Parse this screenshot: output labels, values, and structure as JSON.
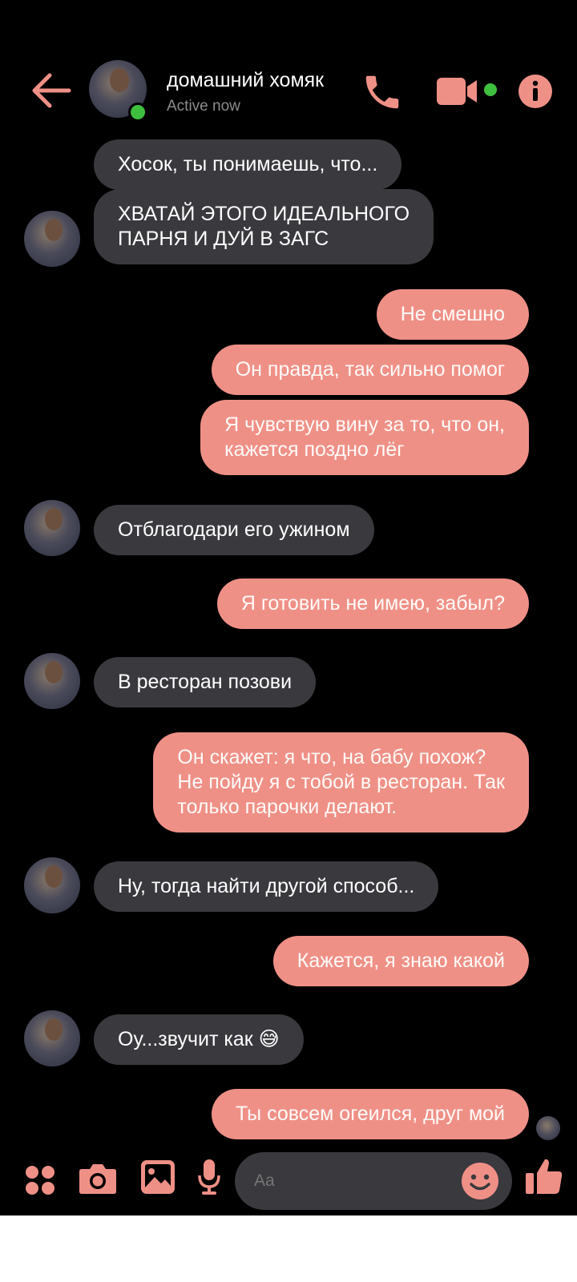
{
  "header": {
    "contact_name": "домашний хомяк",
    "status": "Active now"
  },
  "messages": [
    {
      "side": "in",
      "text": "Хосок, ты понимаешь, что...",
      "avatar": false
    },
    {
      "side": "in",
      "text": "ХВАТАЙ ЭТОГО ИДЕАЛЬНОГО\nПАРНЯ И ДУЙ В ЗАГС",
      "avatar": true
    },
    {
      "side": "out",
      "text": "Не смешно"
    },
    {
      "side": "out",
      "text": "Он правда, так сильно помог"
    },
    {
      "side": "out",
      "text": "Я чувствую вину за то, что он,\nкажется поздно лёг"
    },
    {
      "side": "in",
      "text": "Отблагодари его ужином",
      "avatar": true
    },
    {
      "side": "out",
      "text": "Я готовить не имею, забыл?"
    },
    {
      "side": "in",
      "text": "В ресторан позови",
      "avatar": true
    },
    {
      "side": "out",
      "text": "Он скажет: я что, на бабу похож?\nНе пойду я с тобой в ресторан. Так\nтолько парочки делают."
    },
    {
      "side": "in",
      "text": "Ну, тогда найти другой способ...",
      "avatar": true
    },
    {
      "side": "out",
      "text": "Кажется, я знаю какой"
    },
    {
      "side": "in",
      "text": "Оу...звучит как 😅",
      "avatar": true
    },
    {
      "side": "out",
      "text": "Ты совсем огеился, друг мой"
    }
  ],
  "composer": {
    "placeholder": "Aa"
  },
  "colors": {
    "accent": "#ef9087",
    "incoming_bubble": "#3a393e",
    "online": "#3fbf3f",
    "background": "#000000"
  },
  "icons": [
    "back-arrow-icon",
    "phone-icon",
    "video-camera-icon",
    "info-icon",
    "apps-grid-icon",
    "camera-icon",
    "gallery-icon",
    "microphone-icon",
    "emoji-icon",
    "thumbs-up-icon"
  ]
}
